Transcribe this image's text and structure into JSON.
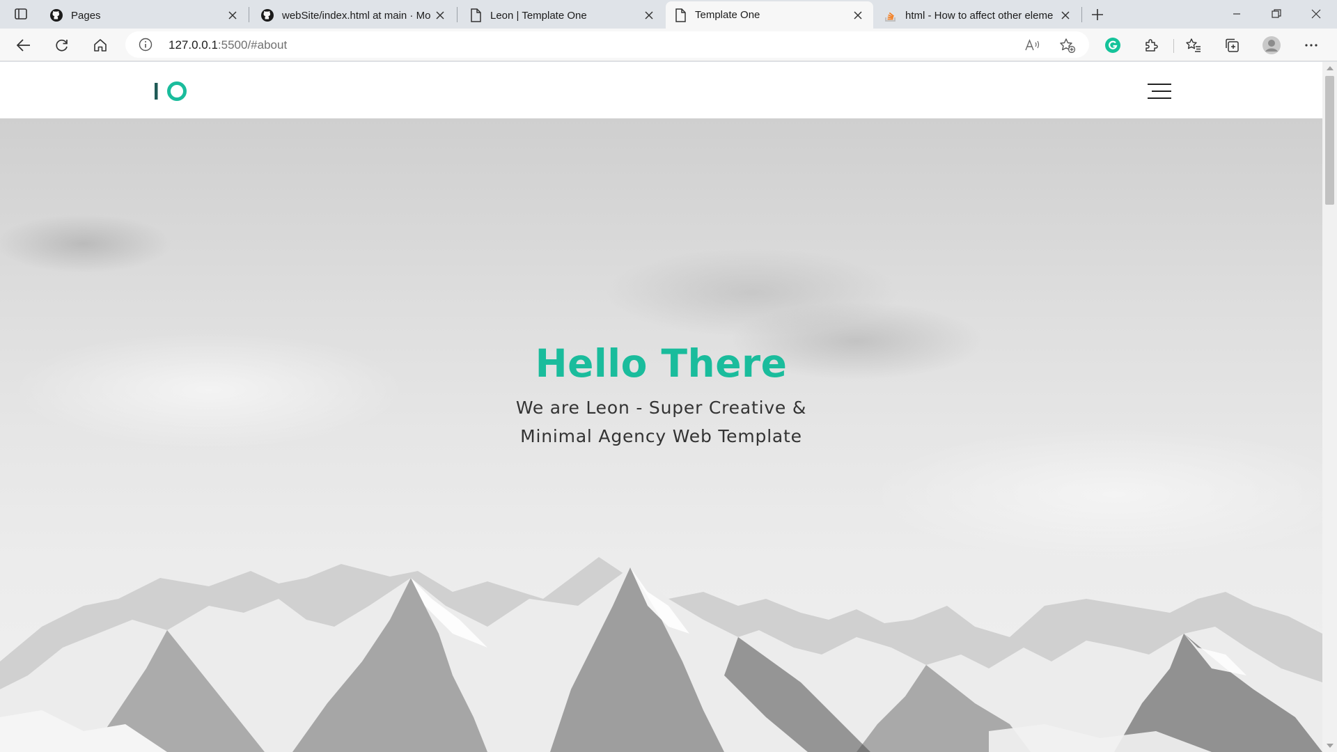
{
  "browser": {
    "tabs": [
      {
        "title": "Pages",
        "icon": "github-icon"
      },
      {
        "title": "webSite/index.html at main · Mo",
        "icon": "github-icon"
      },
      {
        "title": "Leon | Template One",
        "icon": "page-icon"
      },
      {
        "title": "Template One",
        "icon": "page-icon",
        "active": true
      },
      {
        "title": "html - How to affect other eleme",
        "icon": "stackoverflow-icon"
      }
    ],
    "address": {
      "host": "127.0.0.1",
      "rest": ":5500/#about"
    }
  },
  "site": {
    "logo": {
      "text": "IO",
      "accent": "#1abc9c",
      "dark": "#1f5a56"
    },
    "hero": {
      "title": "Hello There",
      "subtitle_line1": "We are Leon - Super Creative &",
      "subtitle_line2": "Minimal Agency Web Template"
    }
  },
  "colors": {
    "accent": "#1abc9c",
    "text": "#333333",
    "chrome": "#dfe3e8",
    "toolbar": "#f7f7f7"
  }
}
